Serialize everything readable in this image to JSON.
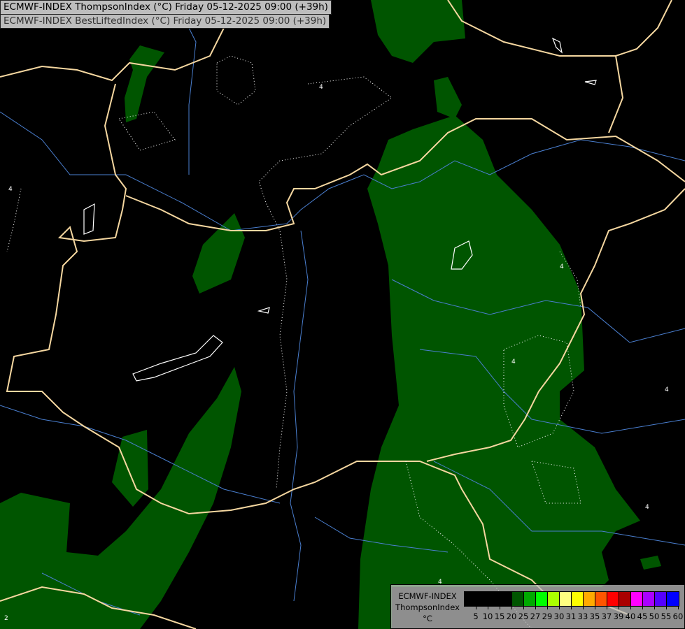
{
  "header": {
    "line1": "ECMWF-INDEX ThompsonIndex (°C) Friday 05-12-2025 09:00 (+39h)",
    "line2": "ECMWF-INDEX BestLiftedIndex (°C) Friday 05-12-2025 09:00 (+39h)"
  },
  "contour_labels": [
    "4",
    "4",
    "4",
    "4",
    "4",
    "4",
    "4",
    "2"
  ],
  "legend": {
    "title_line1": "ECMWF-INDEX",
    "title_line2": "ThompsonIndex",
    "unit": "°C",
    "colors": [
      "#000000",
      "#000000",
      "#000000",
      "#000000",
      "#005500",
      "#00aa00",
      "#00ff00",
      "#aaff00",
      "#ffff80",
      "#ffff00",
      "#ffaa00",
      "#ff5500",
      "#ff0000",
      "#aa0000",
      "#ff00ff",
      "#aa00ff",
      "#5500ff",
      "#0000ff"
    ],
    "ticks": [
      "5",
      "10",
      "15",
      "20",
      "25",
      "27",
      "29",
      "30",
      "31",
      "33",
      "35",
      "37",
      "39",
      "40",
      "45",
      "50",
      "55",
      "60"
    ]
  },
  "colors": {
    "border": "#f5d7a0",
    "river": "#4a7fd0",
    "fill": "#005500"
  }
}
